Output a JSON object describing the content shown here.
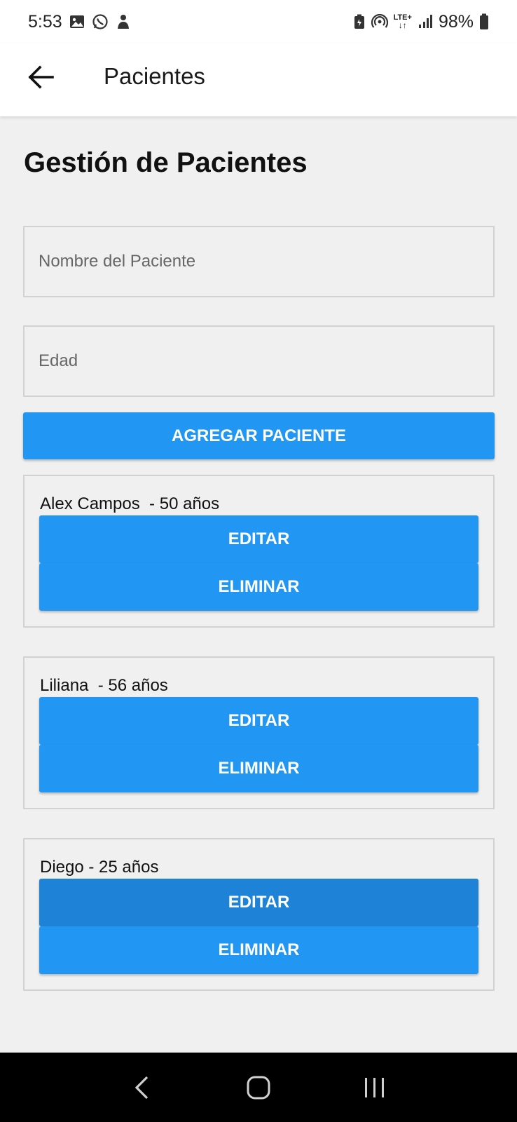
{
  "status_bar": {
    "time": "5:53",
    "battery": "98%",
    "network": "LTE+",
    "icons_left": [
      "image-icon",
      "whatsapp-icon",
      "notification-icon"
    ],
    "icons_right": [
      "battery-saver-icon",
      "hotspot-icon",
      "lte-icon",
      "signal-icon",
      "battery-icon"
    ]
  },
  "app_bar": {
    "title": "Pacientes",
    "back_icon": "arrow-left-icon"
  },
  "page": {
    "heading": "Gestión de Pacientes"
  },
  "form": {
    "name_placeholder": "Nombre del Paciente",
    "name_value": "",
    "age_placeholder": "Edad",
    "age_value": "",
    "add_button": "AGREGAR PACIENTE"
  },
  "patients": [
    {
      "label": "Alex Campos  - 50 años",
      "edit": "EDITAR",
      "delete": "ELIMINAR"
    },
    {
      "label": "Liliana  - 56 años",
      "edit": "EDITAR",
      "delete": "ELIMINAR"
    },
    {
      "label": "Diego - 25 años",
      "edit": "EDITAR",
      "delete": "ELIMINAR"
    }
  ],
  "colors": {
    "accent": "#2196f3",
    "accent_pressed": "#1e82d6",
    "background": "#f0f0f0",
    "border": "#d2d2d2",
    "nav_bar": "#000000"
  }
}
